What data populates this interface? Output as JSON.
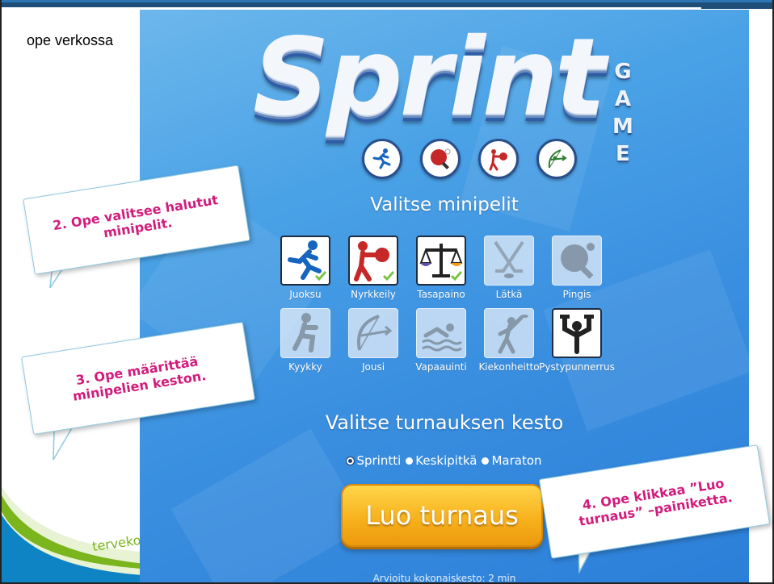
{
  "slide": {
    "corner_label": "ope verkossa",
    "logo_text": "terveko"
  },
  "game": {
    "logo_title": "Sprint",
    "logo_side_letters": [
      "G",
      "A",
      "M",
      "E"
    ],
    "sport_icons": [
      "runner-icon",
      "ping-pong-icon",
      "boxing-icon",
      "archery-icon"
    ],
    "minigames_heading": "Valitse minipelit",
    "minigames": [
      {
        "label": "Juoksu",
        "icon": "runner-icon",
        "selected": true
      },
      {
        "label": "Nyrkkeily",
        "icon": "boxing-icon",
        "selected": true
      },
      {
        "label": "Tasapaino",
        "icon": "balance-scale-icon",
        "selected": true
      },
      {
        "label": "Lätkä",
        "icon": "hockey-sticks-icon",
        "selected": false
      },
      {
        "label": "Pingis",
        "icon": "ping-pong-icon",
        "selected": false
      },
      {
        "label": "Kyykky",
        "icon": "squat-icon",
        "selected": false
      },
      {
        "label": "Jousi",
        "icon": "bow-arrow-icon",
        "selected": false
      },
      {
        "label": "Vapaauinti",
        "icon": "swimmer-icon",
        "selected": false
      },
      {
        "label": "Kiekonheitto",
        "icon": "disc-throw-icon",
        "selected": false
      },
      {
        "label": "Pystypunnerrus",
        "icon": "dumbbell-press-icon",
        "selected": false
      }
    ],
    "duration_heading": "Valitse turnauksen kesto",
    "durations": [
      {
        "label": "Sprintti",
        "selected": true
      },
      {
        "label": "Keskipitkä",
        "selected": false
      },
      {
        "label": "Maraton",
        "selected": false
      }
    ],
    "create_button": "Luo turnaus",
    "estimate": "Arvioitu kokonaiskesto: 2 min"
  },
  "callouts": {
    "c2": "2. Ope valitsee halutut minipelit.",
    "c3": "3. Ope määrittää minipelien keston.",
    "c4": "4. Ope klikkaa ”Luo turnaus” –painiketta."
  },
  "colors": {
    "callout_text": "#d21b7c",
    "panel_blue": "#3a8fe0",
    "button_orange": "#f7b21d",
    "check_green": "#7cc242"
  }
}
